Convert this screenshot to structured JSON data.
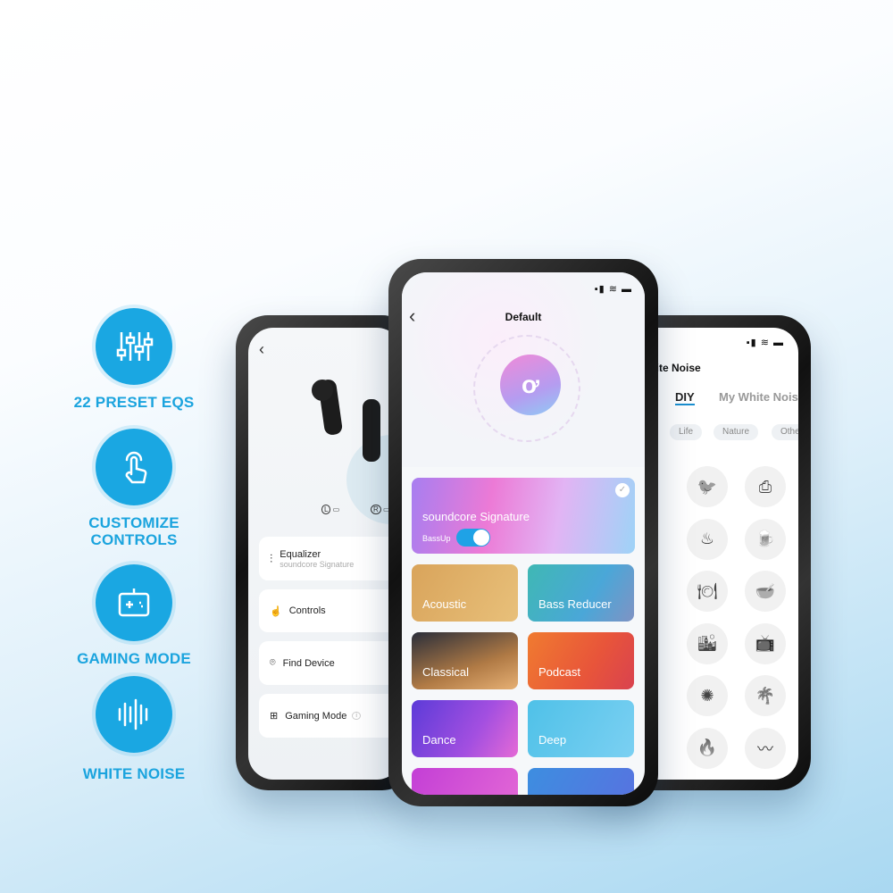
{
  "features": [
    {
      "label_lines": [
        "22 PRESET EQS"
      ],
      "icon": "equalizer-sliders-icon"
    },
    {
      "label_lines": [
        "CUSTOMIZE",
        "CONTROLS"
      ],
      "icon": "tap-hand-icon"
    },
    {
      "label_lines": [
        "GAMING MODE"
      ],
      "icon": "gamepad-icon"
    },
    {
      "label_lines": [
        "WHITE NOISE"
      ],
      "icon": "sound-wave-icon"
    }
  ],
  "left_phone": {
    "earbud_left": "L",
    "earbud_right": "R",
    "menu": [
      {
        "label": "Equalizer",
        "sub": "soundcore Signature",
        "icon": "equalizer-icon"
      },
      {
        "label": "Controls",
        "icon": "tap-hand-icon"
      },
      {
        "label": "Find Device",
        "icon": "location-pin-icon"
      },
      {
        "label": "Gaming Mode",
        "icon": "gamepad-icon",
        "info": "i"
      }
    ]
  },
  "center_phone": {
    "title": "Default",
    "signature": {
      "label": "soundcore Signature",
      "toggle_label": "BassUp",
      "toggle_on": true,
      "selected": true
    },
    "presets": [
      "Acoustic",
      "Bass Reducer",
      "Classical",
      "Podcast",
      "Dance",
      "Deep"
    ]
  },
  "right_phone": {
    "title": "White Noise",
    "tabs": [
      "DIY",
      "My White Noise"
    ],
    "active_tab": "DIY",
    "chips": [
      "Life",
      "Nature",
      "Other"
    ],
    "sounds": [
      "bird-icon",
      "printer-icon",
      "grill-icon",
      "beer-icon",
      "restaurant-icon",
      "cooking-icon",
      "city-icon",
      "tv-icon",
      "fireworks-icon",
      "beach-icon",
      "campfire-icon",
      "wind-icon"
    ]
  },
  "colors": {
    "accent": "#1aa7e2",
    "toggle": "#1fa2e6"
  }
}
